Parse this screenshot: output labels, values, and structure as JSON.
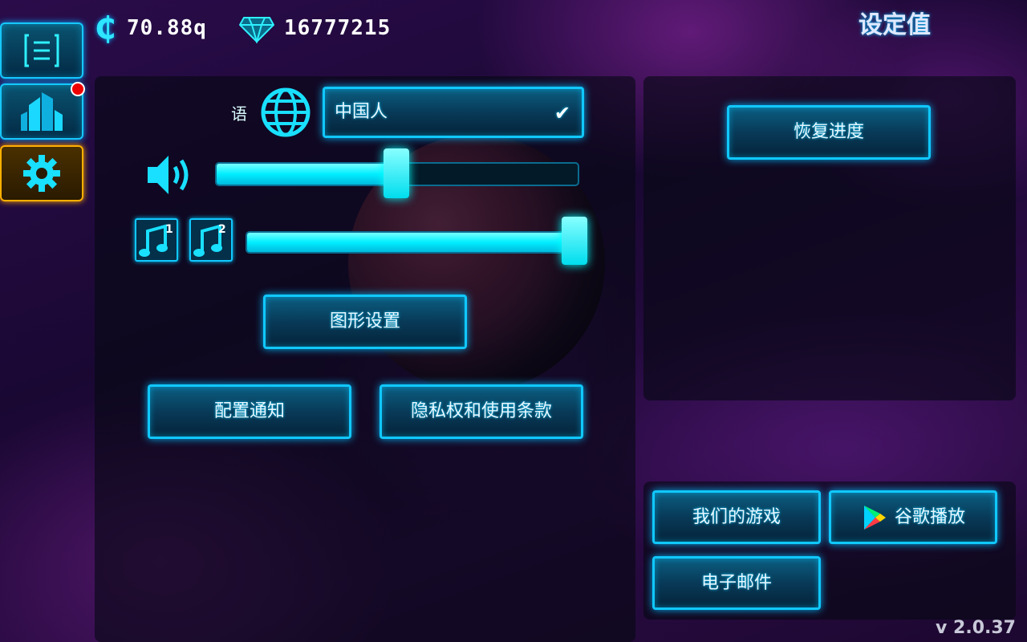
{
  "currency": {
    "coin_symbol": "₵",
    "coin_value": "70.88q",
    "gem_icon": "diamond-icon",
    "gem_value": "16777215"
  },
  "page": {
    "title": "设定值"
  },
  "sidebar": {
    "tabs": [
      {
        "icon": "list-icon",
        "active": false
      },
      {
        "icon": "buildings-icon",
        "active": false,
        "has_badge": true
      },
      {
        "icon": "gear-icon",
        "active": true
      }
    ]
  },
  "language": {
    "label": "语",
    "icon": "globe-icon",
    "selected": "中国人",
    "check_glyph": "✔"
  },
  "audio": {
    "sound_effects_level": 0.5,
    "music_level": 1.0,
    "music_tracks": [
      "1",
      "2"
    ]
  },
  "buttons": {
    "graphics": "图形设置",
    "notifications": "配置通知",
    "privacy": "隐私权和使用条款",
    "restore": "恢复进度",
    "our_games": "我们的游戏",
    "google_play": "谷歌播放",
    "email": "电子邮件"
  },
  "colors": {
    "accent": "#10c8ff",
    "active_tab": "#ffb000",
    "badge": "#ee0000"
  },
  "version": "v 2.0.37"
}
